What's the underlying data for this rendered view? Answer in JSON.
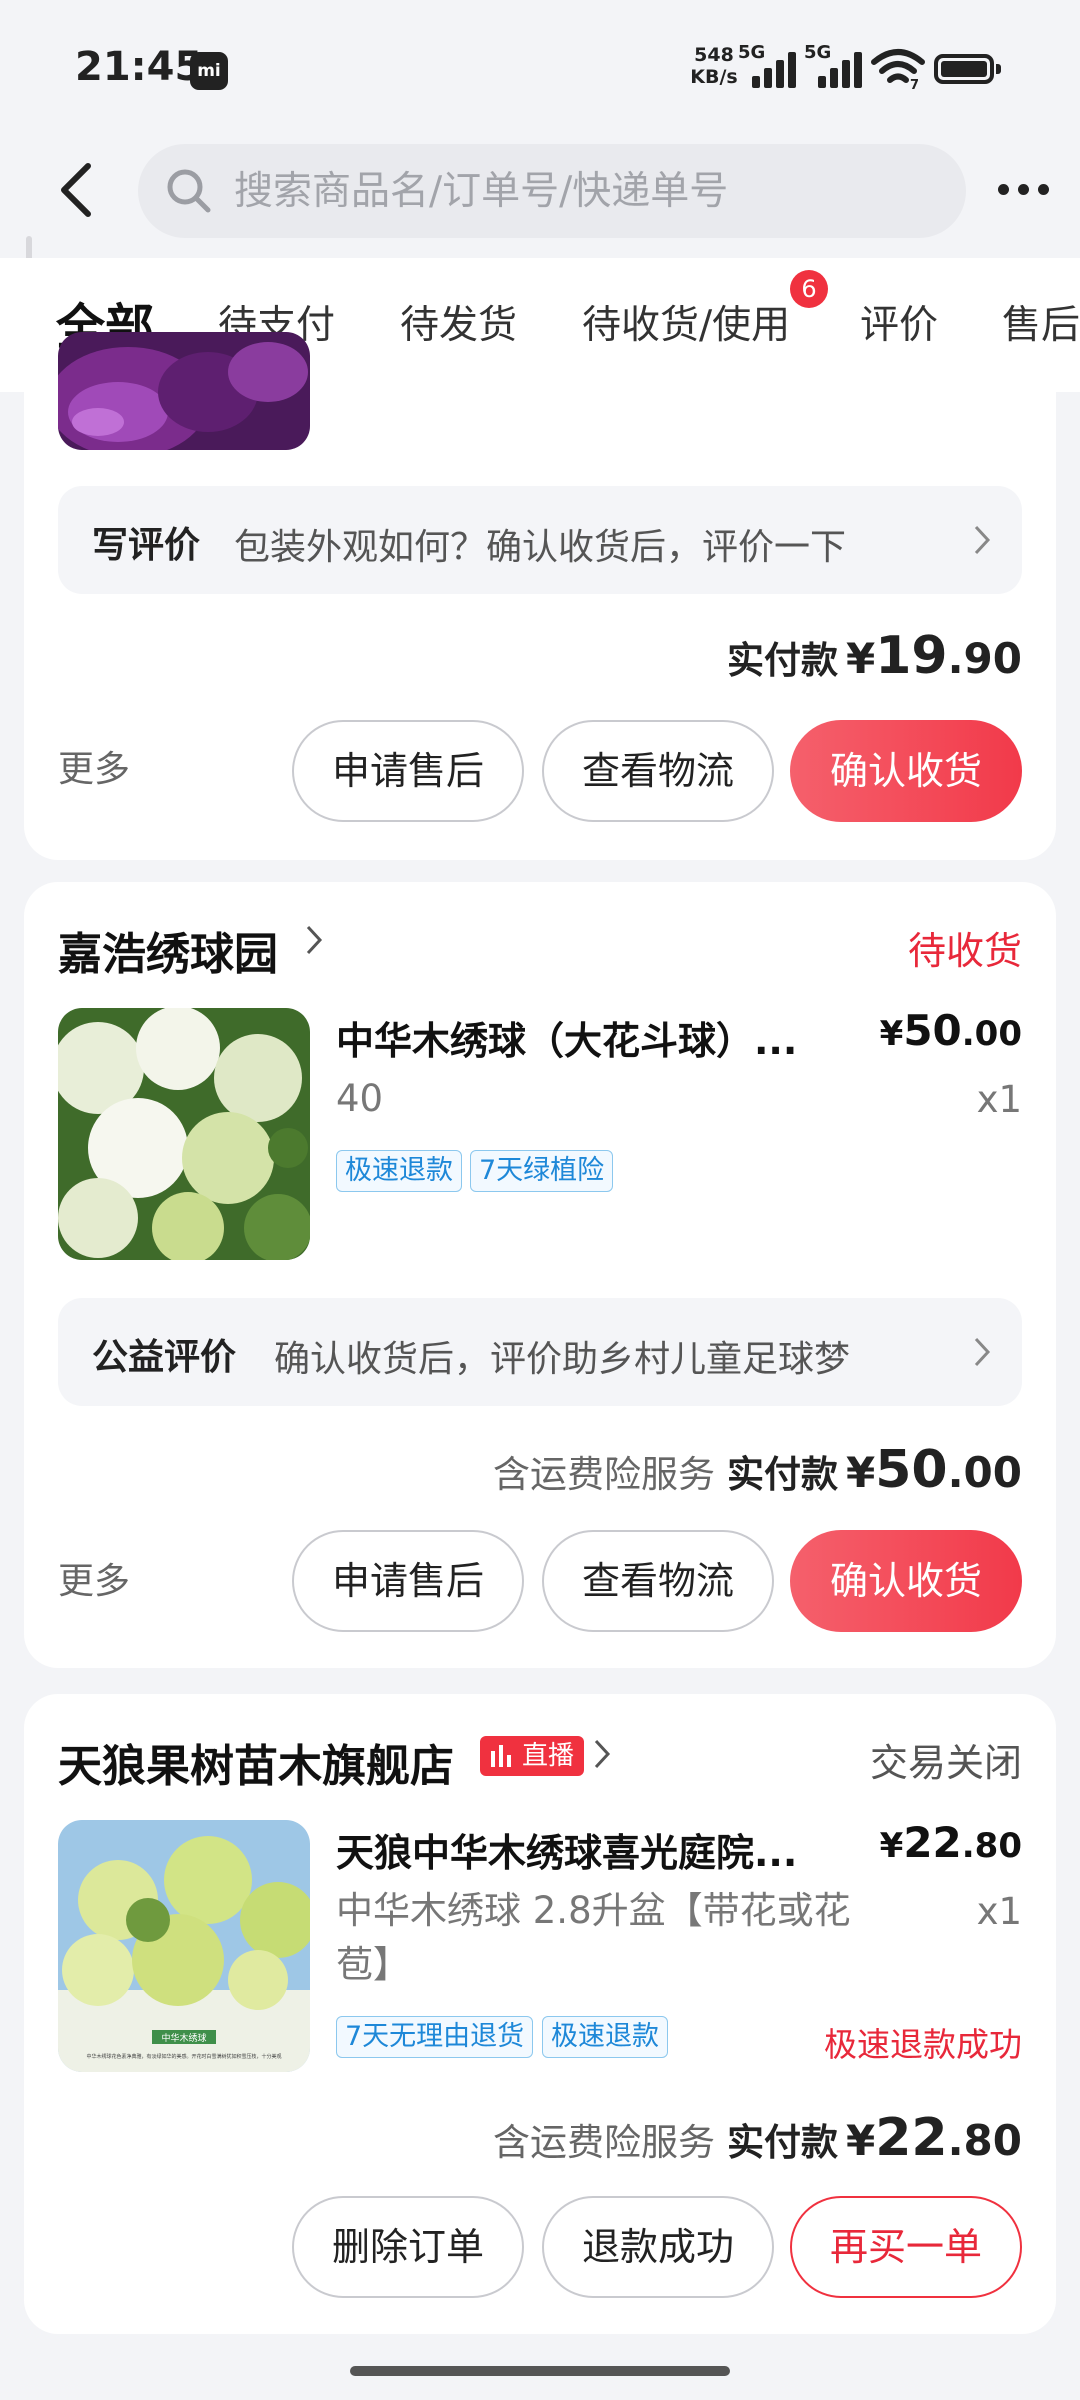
{
  "status_bar": {
    "time": "21:45",
    "mi_label": "mi",
    "net_speed_value": "548",
    "net_speed_unit": "KB/s",
    "sim1": "5G",
    "sim2": "5G",
    "wifi_label": "7"
  },
  "header": {
    "search_placeholder": "搜索商品名/订单号/快递单号"
  },
  "tabs": [
    {
      "label": "全部",
      "active": true
    },
    {
      "label": "待支付"
    },
    {
      "label": "待发货"
    },
    {
      "label": "待收货/使用",
      "badge": "6"
    },
    {
      "label": "评价"
    },
    {
      "label": "售后"
    }
  ],
  "orders": [
    {
      "review_title": "写评价",
      "review_hint": "包装外观如何？确认收货后，评价一下",
      "paid_label": "实付款",
      "paid_currency": "¥",
      "paid_int": "19",
      "paid_dec": ".90",
      "more": "更多",
      "buttons": [
        "申请售后",
        "查看物流",
        "确认收货"
      ]
    },
    {
      "shop": "嘉浩绣球园",
      "status": "待收货",
      "product_title": "中华木绣球（大花斗球）...",
      "price_currency": "¥",
      "price_int": "50",
      "price_dec": ".00",
      "spec": "40",
      "qty": "x1",
      "tags": [
        "极速退款",
        "7天绿植险"
      ],
      "review_title": "公益评价",
      "review_hint": "确认收货后，评价助乡村儿童足球梦",
      "service": "含运费险服务",
      "paid_label": "实付款",
      "paid_currency": "¥",
      "paid_int": "50",
      "paid_dec": ".00",
      "more": "更多",
      "buttons": [
        "申请售后",
        "查看物流",
        "确认收货"
      ]
    },
    {
      "shop": "天狼果树苗木旗舰店",
      "live_badge": "直播",
      "status": "交易关闭",
      "product_title": "天狼中华木绣球喜光庭院...",
      "price_currency": "¥",
      "price_int": "22",
      "price_dec": ".80",
      "spec": "中华木绣球 2.8升盆【带花或花苞】",
      "qty": "x1",
      "tags": [
        "7天无理由退货",
        "极速退款"
      ],
      "refund_status": "极速退款成功",
      "thumb_caption_title": "中华木绣球",
      "thumb_caption_text": "中华木绣球花色素净典雅，有淡绿如华的美感。开花时白雪满树犹如积雪压枝，十分美观",
      "service": "含运费险服务",
      "paid_label": "实付款",
      "paid_currency": "¥",
      "paid_int": "22",
      "paid_dec": ".80",
      "buttons": [
        "删除订单",
        "退款成功",
        "再买一单"
      ]
    }
  ],
  "colors": {
    "accent": "#f0313f",
    "background": "#f3f4f7",
    "tag_blue": "#1e88d8"
  }
}
